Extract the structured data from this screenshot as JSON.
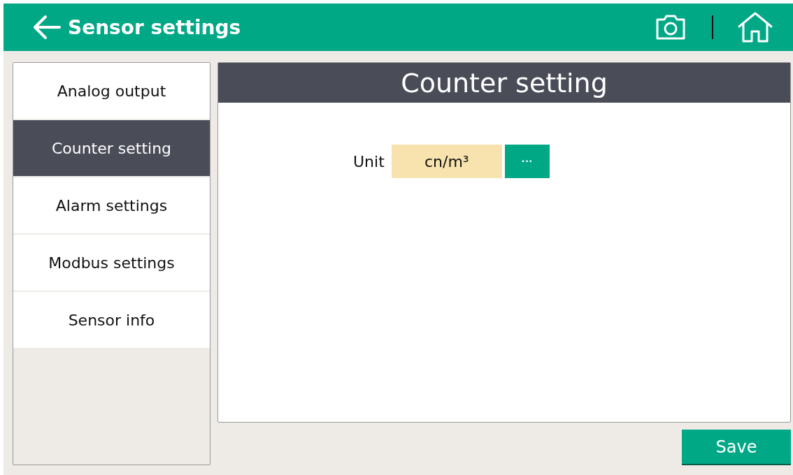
{
  "header": {
    "title": "Sensor settings"
  },
  "sidebar": {
    "items": [
      {
        "label": "Analog output",
        "selected": false
      },
      {
        "label": "Counter setting",
        "selected": true
      },
      {
        "label": "Alarm settings",
        "selected": false
      },
      {
        "label": "Modbus settings",
        "selected": false
      },
      {
        "label": "Sensor info",
        "selected": false
      }
    ]
  },
  "panel": {
    "title": "Counter setting",
    "fields": [
      {
        "label": "Unit",
        "value": "cn/m³",
        "button": "···"
      }
    ]
  },
  "buttons": [
    "Save"
  ]
}
